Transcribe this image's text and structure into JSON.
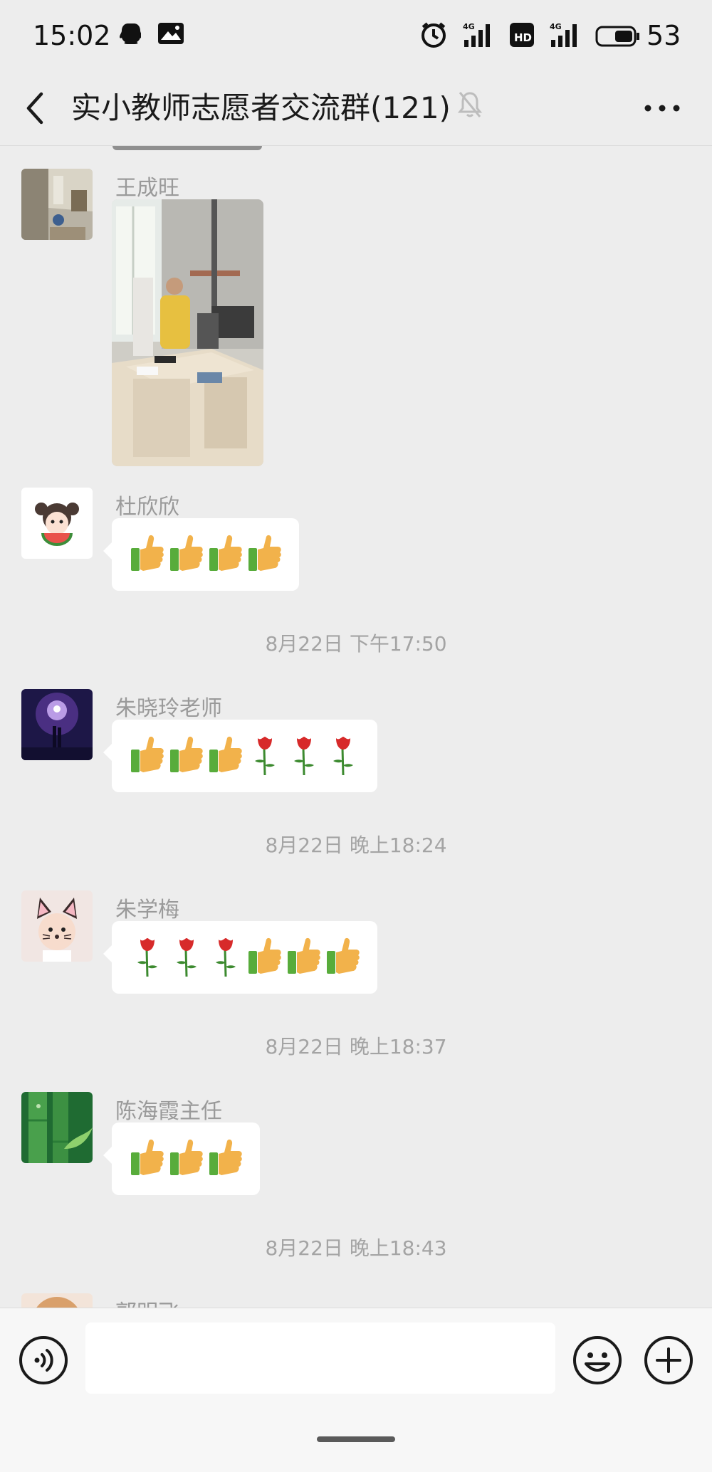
{
  "status_bar": {
    "time": "15:02",
    "icons": [
      "qq-icon",
      "gallery-icon",
      "alarm-icon",
      "4g-signal-icon",
      "hd-icon",
      "4g-signal-2-icon",
      "battery-icon"
    ],
    "battery": "53",
    "signal_label": "4G"
  },
  "header": {
    "title": "实小教师志愿者交流群(121)",
    "back_icon": "chevron-left-icon",
    "mute_icon": "bell-off-icon",
    "more_icon": "more-horizontal-icon"
  },
  "messages": [
    {
      "sender": "王成旺",
      "type": "image"
    },
    {
      "sender": "杜欣欣",
      "type": "emoji",
      "emojis": [
        "👍",
        "👍",
        "👍",
        "👍"
      ]
    },
    {
      "sender": "朱晓玲老师",
      "type": "emoji",
      "emojis": [
        "👍",
        "👍",
        "👍",
        "🌹",
        "🌹",
        "🌹"
      ]
    },
    {
      "sender": "朱学梅",
      "type": "emoji",
      "emojis": [
        "🌹",
        "🌹",
        "🌹",
        "👍",
        "👍",
        "👍"
      ]
    },
    {
      "sender": "陈海霞主任",
      "type": "emoji",
      "emojis": [
        "👍",
        "👍",
        "👍"
      ]
    },
    {
      "sender": "郭明飞",
      "type": "partial"
    }
  ],
  "timestamps": [
    "8月22日 下午17:50",
    "8月22日 晚上18:24",
    "8月22日 晚上18:37",
    "8月22日 晚上18:43"
  ],
  "input_bar": {
    "voice_icon": "voice-icon",
    "emoji_icon": "smiley-icon",
    "plus_icon": "plus-icon",
    "input_value": ""
  },
  "colors": {
    "background": "#ededed",
    "bubble": "#ffffff",
    "meta_text": "#a4a4a4"
  }
}
